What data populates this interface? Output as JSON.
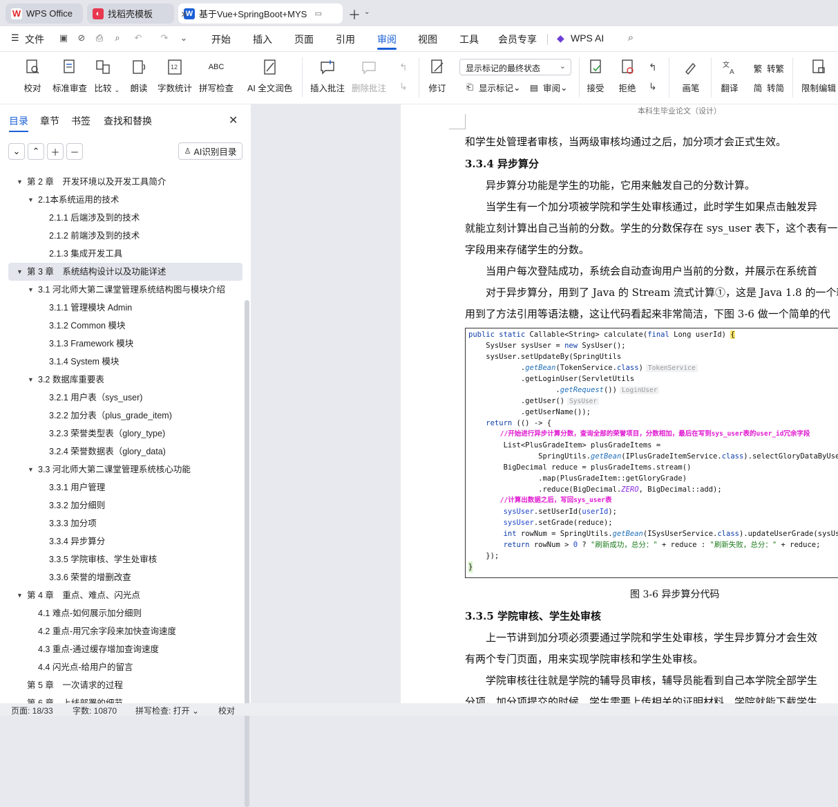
{
  "tabs": [
    {
      "label": "WPS Office",
      "icon": "wps-logo-icon"
    },
    {
      "label": "找稻壳模板",
      "icon": "docer-icon"
    },
    {
      "label": "基于Vue+SpringBoot+MYS",
      "icon": "word-doc-icon",
      "active": true
    }
  ],
  "menu": {
    "file": "文件",
    "items": [
      "开始",
      "插入",
      "页面",
      "引用",
      "审阅",
      "视图",
      "工具",
      "会员专享",
      "WPS AI"
    ],
    "active": "审阅"
  },
  "ribbon": {
    "proofread": "校对",
    "standard_review": "标准审查",
    "compare": "比较",
    "read_aloud": "朗读",
    "word_count": "字数统计",
    "spell_check": "拼写检查",
    "ai_polish": "AI 全文润色",
    "insert_comment": "插入批注",
    "delete_comment": "删除批注",
    "revise": "修订",
    "display_select": "显示标记的最终状态",
    "show_markup": "显示标记",
    "review": "审阅",
    "accept": "接受",
    "reject": "拒绝",
    "pen": "画笔",
    "translate": "翻译",
    "to_traditional": "转繁",
    "to_simplified": "转简",
    "restrict_edit": "限制编辑"
  },
  "sidebar": {
    "tabs": [
      "目录",
      "章节",
      "书签",
      "查找和替换"
    ],
    "active_tab": "目录",
    "ai_button": "AI识别目录",
    "toc": [
      {
        "text": "第 2 章　开发环境以及开发工具简介",
        "level": 1,
        "expanded": true
      },
      {
        "text": "2.1本系统运用的技术",
        "level": 2,
        "expanded": true
      },
      {
        "text": "2.1.1  后端涉及到的技术",
        "level": 3
      },
      {
        "text": "2.1.2  前端涉及到的技术",
        "level": 3
      },
      {
        "text": "2.1.3  集成开发工具",
        "level": 3
      },
      {
        "text": "第 3 章　系统结构设计以及功能详述",
        "level": 1,
        "expanded": true,
        "selected": true
      },
      {
        "text": "3.1  河北师大第二课堂管理系统结构图与模块介绍",
        "level": 2,
        "expanded": true
      },
      {
        "text": "3.1.1  管理模块 Admin",
        "level": 3
      },
      {
        "text": "3.1.2 Common 模块",
        "level": 3
      },
      {
        "text": "3.1.3 Framework 模块",
        "level": 3
      },
      {
        "text": "3.1.4 System 模块",
        "level": 3
      },
      {
        "text": "3.2  数据库重要表",
        "level": 2,
        "expanded": true
      },
      {
        "text": "3.2.1  用户表（sys_user)",
        "level": 3
      },
      {
        "text": "3.2.2  加分表（plus_grade_item)",
        "level": 3
      },
      {
        "text": "3.2.3  荣誉类型表（glory_type)",
        "level": 3
      },
      {
        "text": "3.2.4  荣誉数据表（glory_data)",
        "level": 3
      },
      {
        "text": "3.3  河北师大第二课堂管理系统核心功能",
        "level": 2,
        "expanded": true
      },
      {
        "text": "3.3.1  用户管理",
        "level": 3
      },
      {
        "text": "3.3.2  加分细则",
        "level": 3
      },
      {
        "text": "3.3.3  加分项",
        "level": 3
      },
      {
        "text": "3.3.4  异步算分",
        "level": 3
      },
      {
        "text": "3.3.5  学院审核、学生处审核",
        "level": 3
      },
      {
        "text": "3.3.6  荣誉的增删改查",
        "level": 3
      },
      {
        "text": "第 4 章　重点、难点、闪光点",
        "level": 1,
        "expanded": true
      },
      {
        "text": "4.1  难点-如何展示加分细则",
        "level": 2
      },
      {
        "text": "4.2  重点-用冗余字段来加快查询速度",
        "level": 2
      },
      {
        "text": "4.3  重点-通过缓存增加查询速度",
        "level": 2
      },
      {
        "text": "4.4  闪光点-给用户的留言",
        "level": 2
      },
      {
        "text": "第 5 章　一次请求的过程",
        "level": 1
      },
      {
        "text": "第 6 章　上线部署的细节",
        "level": 1
      }
    ]
  },
  "document": {
    "header": "本科生毕业论文（设计）",
    "lines": [
      "和学生处管理者审核，当两级审核均通过之后，加分项才会正式生效。",
      "3.3.4  异步算分",
      "　　异步算分功能是学生的功能，它用来触发自己的分数计算。",
      "　　当学生有一个加分项被学院和学生处审核通过，此时学生如果点击触发异",
      "就能立刻计算出自己当前的分数。学生的分数保存在 sys_user 表下，这个表有一",
      "字段用来存储学生的分数。",
      "　　当用户每次登陆成功，系统会自动查询用户当前的分数，并展示在系统首",
      "　　对于异步算分，用到了 Java 的 Stream 流式计算①，这是 Java 1.8 的一个新",
      "用到了方法引用等语法糖，这让代码看起来非常简洁，下图 3-6 做一个简单的代"
    ],
    "caption": "图 3-6 异步算分代码",
    "lines_after": [
      "3.3.5  学院审核、学生处审核",
      "　　上一节讲到加分项必须要通过学院和学生处审核，学生异步算分才会生效",
      "有两个专门页面，用来实现学院审核和学生处审核。",
      "　　学院审核往往就是学院的辅导员审核，辅导员能看到自己本学院全部学生",
      "分项。加分项提交的时候，学生需要上传相关的证明材料，学院就能下载学生"
    ],
    "code": {
      "l1": "public static Callable<String> calculate(final Long userId) {",
      "l2": "    SysUser sysUser = new SysUser();",
      "l3": "    sysUser.setUpdateBy(SpringUtils",
      "l4a": "            .",
      "l4b": "getBean",
      "l4c": "(TokenService.",
      "l4d": "class",
      "l4e": ")",
      "l4tag": "TokenService",
      "l5": "            .getLoginUser(ServletUtils",
      "l6a": "                    .",
      "l6b": "getRequest",
      "l6c": "())",
      "l6tag": "LoginUser",
      "l7": "            .getUser()",
      "l7tag": "SysUser",
      "l8": "            .getUserName());",
      "l9a": "    return",
      "l9b": " (() -> {",
      "l10": "        //开始进行异步计算分数，查询全部的荣誉项目，分数相加，最后在写到sys_user表的user_id冗余字段",
      "l11": "        List<PlusGradeItem> plusGradeItems =",
      "l12a": "                SpringUtils.",
      "l12b": "getBean",
      "l12c": "(IPlusGradeItemService.",
      "l12d": "class",
      "l12e": ").selectGloryDataByUserI",
      "l13": "        BigDecimal reduce = plusGradeItems.stream()",
      "l14": "                .map(PlusGradeItem::getGloryGrade)",
      "l15a": "                .reduce(BigDecimal.",
      "l15b": "ZERO",
      "l15c": ", BigDecimal::add);",
      "l16": "        //计算出数据之后，写回sys_user表",
      "l17a": "        sysUser",
      "l17b": ".setUserId(",
      "l17c": "userId",
      "l17d": ");",
      "l18a": "        sysUser",
      "l18b": ".setGrade(reduce);",
      "l19a": "        int",
      "l19b": " rowNum = SpringUtils.",
      "l19c": "getBean",
      "l19d": "(ISysUserService.",
      "l19e": "class",
      "l19f": ").updateUserGrade(sysUser",
      "l20a": "        return",
      "l20b": " rowNum > ",
      "l20c": "0",
      "l20d": " ? ",
      "l20e": "\"刷新成功，总分：\"",
      "l20f": " + reduce : ",
      "l20g": "\"刷新失败，总分：\"",
      "l20h": " + reduce;",
      "l21": "    });",
      "l22": "}"
    }
  },
  "status": {
    "page": "页面: 18/33",
    "words": "字数: 10870",
    "spell": "拼写检查: 打开",
    "proof": "校对"
  },
  "colors": {
    "accent": "#1a5fd6",
    "comment": "#e01bd1"
  }
}
